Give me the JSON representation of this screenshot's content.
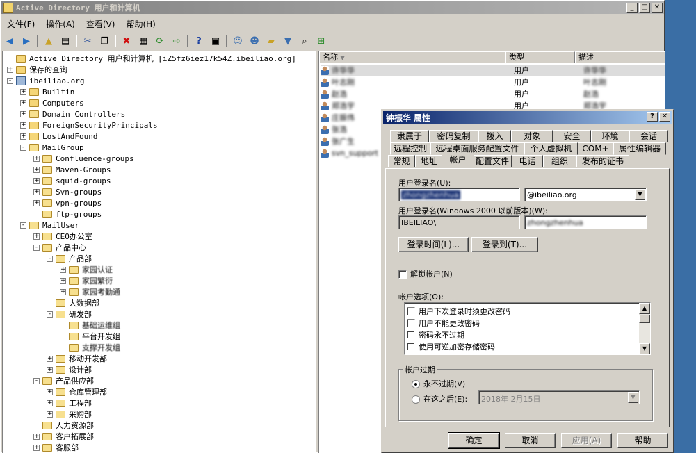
{
  "window": {
    "title": "Active Directory 用户和计算机",
    "min": "_",
    "max": "□",
    "close": "✕"
  },
  "menu": [
    "文件(F)",
    "操作(A)",
    "查看(V)",
    "帮助(H)"
  ],
  "toolbar_icons": [
    "back-icon",
    "forward-icon",
    "up-folder-icon",
    "console-tree-icon",
    "cut-icon",
    "copy-icon",
    "delete-icon",
    "properties-icon",
    "refresh-icon",
    "export-icon",
    "help-icon",
    "console-help-icon",
    "new-user-icon",
    "new-group-icon",
    "new-ou-icon",
    "filter-icon",
    "find-icon",
    "add-to-group-icon"
  ],
  "tree": [
    {
      "label": "Active Directory 用户和计算机 [iZ5fz6iez17k54Z.ibeiliao.org]",
      "level": 0,
      "exp": "",
      "icon": "root"
    },
    {
      "label": "保存的查询",
      "level": 0,
      "exp": "+",
      "icon": "folder"
    },
    {
      "label": "ibeiliao.org",
      "level": 0,
      "exp": "-",
      "icon": "domain"
    },
    {
      "label": "Builtin",
      "level": 1,
      "exp": "+",
      "icon": "folder"
    },
    {
      "label": "Computers",
      "level": 1,
      "exp": "+",
      "icon": "folder"
    },
    {
      "label": "Domain Controllers",
      "level": 1,
      "exp": "+",
      "icon": "ou"
    },
    {
      "label": "ForeignSecurityPrincipals",
      "level": 1,
      "exp": "+",
      "icon": "folder"
    },
    {
      "label": "LostAndFound",
      "level": 1,
      "exp": "+",
      "icon": "folder"
    },
    {
      "label": "MailGroup",
      "level": 1,
      "exp": "-",
      "icon": "ou"
    },
    {
      "label": "Confluence-groups",
      "level": 2,
      "exp": "+",
      "icon": "ou"
    },
    {
      "label": "Maven-Groups",
      "level": 2,
      "exp": "+",
      "icon": "ou"
    },
    {
      "label": "squid-groups",
      "level": 2,
      "exp": "+",
      "icon": "ou"
    },
    {
      "label": "Svn-groups",
      "level": 2,
      "exp": "+",
      "icon": "ou"
    },
    {
      "label": "vpn-groups",
      "level": 2,
      "exp": "+",
      "icon": "ou"
    },
    {
      "label": "ftp-groups",
      "level": 2,
      "exp": "",
      "icon": "ou"
    },
    {
      "label": "MailUser",
      "level": 1,
      "exp": "-",
      "icon": "ou"
    },
    {
      "label": "CEO办公室",
      "level": 2,
      "exp": "+",
      "icon": "ou"
    },
    {
      "label": "产品中心",
      "level": 2,
      "exp": "-",
      "icon": "ou"
    },
    {
      "label": "产品部",
      "level": 3,
      "exp": "-",
      "icon": "ou"
    },
    {
      "label": "家园认证",
      "level": 4,
      "exp": "+",
      "icon": "ou"
    },
    {
      "label": "家园繁衍",
      "level": 4,
      "exp": "+",
      "icon": "ou"
    },
    {
      "label": "家园考勤通",
      "level": 4,
      "exp": "+",
      "icon": "ou"
    },
    {
      "label": "大数据部",
      "level": 3,
      "exp": "",
      "icon": "ou"
    },
    {
      "label": "研发部",
      "level": 3,
      "exp": "-",
      "icon": "ou"
    },
    {
      "label": "基础运维组",
      "level": 4,
      "exp": "",
      "icon": "ou"
    },
    {
      "label": "平台开发组",
      "level": 4,
      "exp": "",
      "icon": "ou"
    },
    {
      "label": "支撑开发组",
      "level": 4,
      "exp": "",
      "icon": "ou"
    },
    {
      "label": "移动开发部",
      "level": 3,
      "exp": "+",
      "icon": "ou"
    },
    {
      "label": "设计部",
      "level": 3,
      "exp": "+",
      "icon": "ou"
    },
    {
      "label": "产品供应部",
      "level": 2,
      "exp": "-",
      "icon": "ou"
    },
    {
      "label": "仓库管理部",
      "level": 3,
      "exp": "+",
      "icon": "ou"
    },
    {
      "label": "工程部",
      "level": 3,
      "exp": "+",
      "icon": "ou"
    },
    {
      "label": "采购部",
      "level": 3,
      "exp": "+",
      "icon": "ou"
    },
    {
      "label": "人力资源部",
      "level": 2,
      "exp": "",
      "icon": "ou"
    },
    {
      "label": "客户拓展部",
      "level": 2,
      "exp": "+",
      "icon": "ou"
    },
    {
      "label": "客服部",
      "level": 2,
      "exp": "+",
      "icon": "ou"
    }
  ],
  "list": {
    "headers": [
      "名称",
      "类型",
      "描述"
    ],
    "rows": [
      {
        "name": "许华华",
        "type": "用户",
        "desc": "许华华"
      },
      {
        "name": "叶志刚",
        "type": "用户",
        "desc": "叶志刚"
      },
      {
        "name": "赵浩",
        "type": "用户",
        "desc": "赵浩"
      },
      {
        "name": "郑浩宇",
        "type": "用户",
        "desc": "郑浩宇"
      },
      {
        "name": "庄振伟",
        "type": "",
        "desc": ""
      },
      {
        "name": "张浩",
        "type": "",
        "desc": ""
      },
      {
        "name": "张广生",
        "type": "",
        "desc": ""
      },
      {
        "name": "svn_support",
        "type": "",
        "desc": ""
      }
    ]
  },
  "dialog": {
    "title": "钟振华 属性",
    "help": "?",
    "close": "✕",
    "tabs_row1": [
      "隶属于",
      "密码复制",
      "拨入",
      "对象",
      "安全",
      "环境",
      "会话"
    ],
    "tabs_row2": [
      "远程控制",
      "远程桌面服务配置文件",
      "个人虚拟机",
      "COM+",
      "属性编辑器"
    ],
    "tabs_row3": [
      "常规",
      "地址",
      "帐户",
      "配置文件",
      "电话",
      "组织",
      "发布的证书"
    ],
    "logon_label": "用户登录名(U):",
    "logon_value": "zhongzhenhua",
    "upn_suffix": "@ibeiliao.org",
    "legacy_label": "用户登录名(Windows 2000 以前版本)(W):",
    "legacy_domain": "IBEILIAO\\",
    "legacy_value": "zhongzhenhua",
    "logon_hours_btn": "登录时间(L)...",
    "logon_to_btn": "登录到(T)...",
    "unlock_label": "解锁帐户(N)",
    "options_label": "帐户选项(O):",
    "options": [
      "用户下次登录时须更改密码",
      "用户不能更改密码",
      "密码永不过期",
      "使用可逆加密存储密码"
    ],
    "expire_group": "帐户过期",
    "never_label": "永不过期(V)",
    "end_label": "在这之后(E):",
    "end_date": "2018年  2月15日",
    "ok": "确定",
    "cancel": "取消",
    "apply": "应用(A)",
    "helpbtn": "帮助"
  }
}
